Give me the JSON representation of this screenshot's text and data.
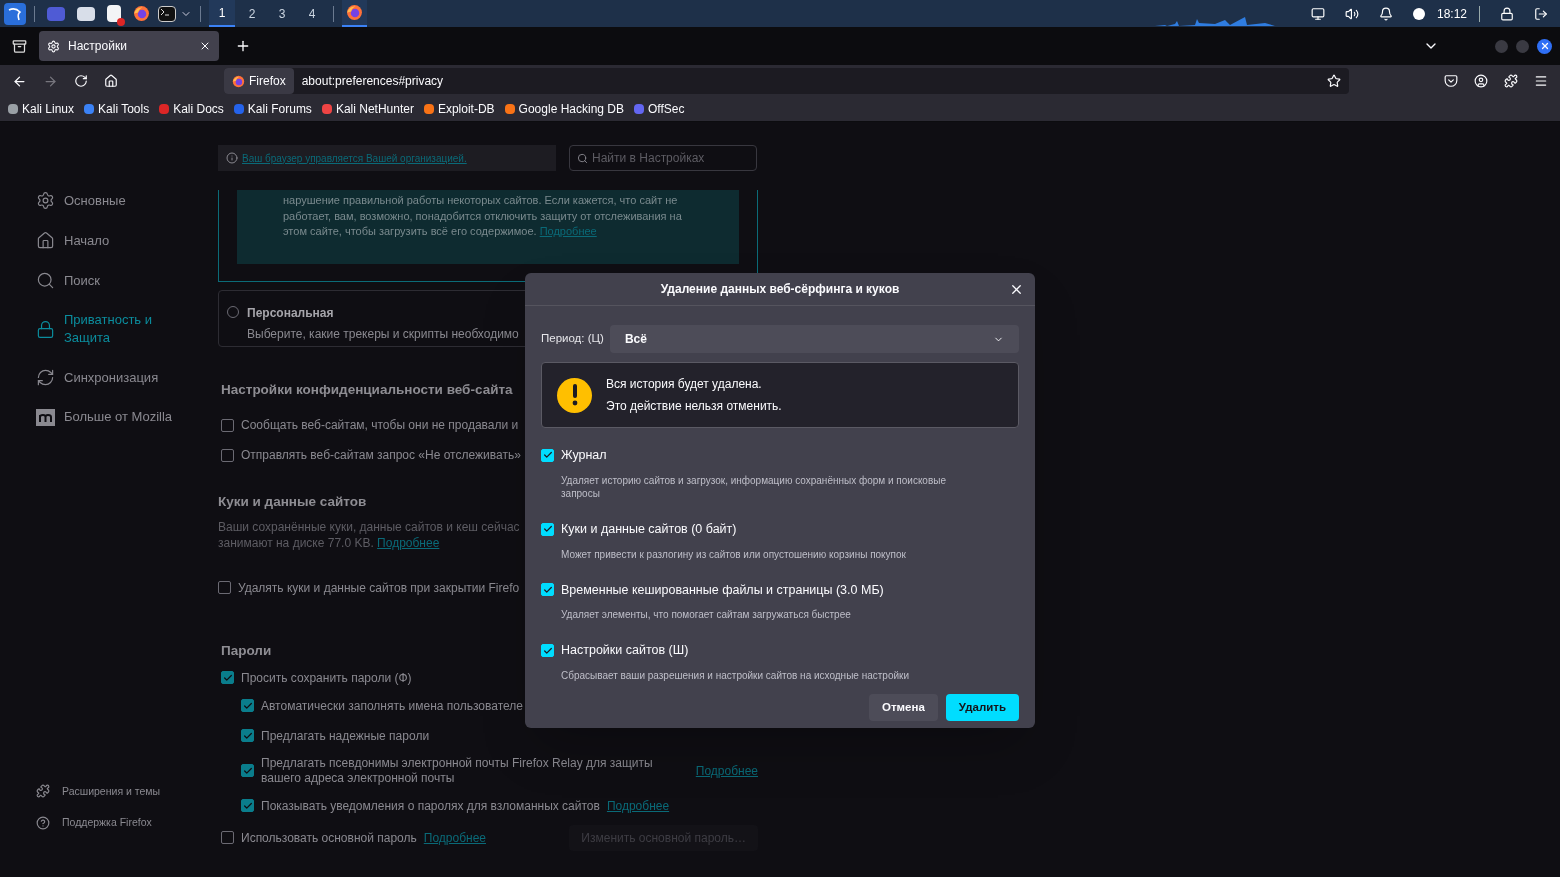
{
  "taskbar": {
    "workspaces": [
      {
        "label": "1",
        "selected": true
      },
      {
        "label": "2",
        "selected": false
      },
      {
        "label": "3",
        "selected": false
      },
      {
        "label": "4",
        "selected": false
      }
    ],
    "clock": "18:12"
  },
  "browser": {
    "tab": {
      "title": "Настройки"
    },
    "identity": "Firefox",
    "url": "about:preferences#privacy",
    "bookmarks": [
      {
        "label": "Kali Linux",
        "color": "#9aa0a6"
      },
      {
        "label": "Kali Tools",
        "color": "#3b82f6"
      },
      {
        "label": "Kali Docs",
        "color": "#dc2626"
      },
      {
        "label": "Kali Forums",
        "color": "#2563eb"
      },
      {
        "label": "Kali NetHunter",
        "color": "#ef4444"
      },
      {
        "label": "Exploit-DB",
        "color": "#f97316"
      },
      {
        "label": "Google Hacking DB",
        "color": "#f97316"
      },
      {
        "label": "OffSec",
        "color": "#6366f1"
      }
    ]
  },
  "settings": {
    "notice": {
      "text": "Ваш браузер управляется Вашей организацией."
    },
    "search": {
      "placeholder": "Найти в Настройках"
    },
    "sidebar": {
      "items": [
        {
          "label": "Основные",
          "selected": false
        },
        {
          "label": "Начало",
          "selected": false
        },
        {
          "label": "Поиск",
          "selected": false
        },
        {
          "label": "Приватность и Защита",
          "selected": true
        },
        {
          "label": "Синхронизация",
          "selected": false
        },
        {
          "label": "Больше от Mozilla",
          "selected": false
        }
      ],
      "footer": [
        "Расширения и темы",
        "Поддержка Firefox"
      ]
    },
    "tracking_card": {
      "text": "нарушение правильной работы некоторых сайтов. Если кажется, что сайт не работает, вам, возможно, понадобится отключить защиту от отслеживания на этом сайте, чтобы загрузить всё его содержимое.",
      "link": "Подробнее"
    },
    "custom_option": {
      "label": "Персональная",
      "description": "Выберите, какие трекеры и скрипты необходимо",
      "selected": false
    },
    "privacy_section": {
      "heading": "Настройки конфиденциальности веб-сайта",
      "options": [
        {
          "label": "Сообщать веб-сайтам, чтобы они не продавали и",
          "checked": false
        },
        {
          "label": "Отправлять веб-сайтам запрос «Не отслеживать»",
          "checked": false
        }
      ]
    },
    "cookies_section": {
      "heading": "Куки и данные сайтов",
      "description": "Ваши сохранённые куки, данные сайтов и кеш сейчас занимают на диске 77.0 KB.",
      "link": "Подробнее",
      "option": {
        "label": "Удалять куки и данные сайтов при закрытии Firefo",
        "checked": false
      }
    },
    "passwords_section": {
      "heading": "Пароли",
      "ask": {
        "label": "Просить сохранить пароли (Ф)",
        "checked": true
      },
      "children": [
        {
          "label": "Автоматически заполнять имена пользователе",
          "checked": true
        },
        {
          "label": "Предлагать надежные пароли",
          "checked": true
        },
        {
          "label": "Предлагать псевдонимы электронной почты Firefox Relay для защиты вашего адреса электронной почты",
          "checked": true,
          "link": "Подробнее",
          "kind": "wide"
        },
        {
          "label": "Показывать уведомления о паролях для взломанных сайтов",
          "checked": true,
          "link": "Подробнее",
          "kind": "inline"
        }
      ],
      "primary": {
        "label": "Использовать основной пароль",
        "checked": false,
        "link": "Подробнее",
        "button": "Изменить основной пароль…",
        "button_disabled": true
      }
    }
  },
  "dialog": {
    "title": "Удаление данных веб-сёрфинга и куков",
    "period": {
      "label": "Период: (Ц)",
      "value": "Всё"
    },
    "warning": [
      "Вся история будет удалена.",
      "Это действие нельзя отменить."
    ],
    "options": [
      {
        "label": "Журнал",
        "description": "Удаляет историю сайтов и загрузок, информацию сохранённых форм и поисковые запросы",
        "checked": true
      },
      {
        "label": "Куки и данные сайтов (0 байт)",
        "description": "Может привести к разлогину из сайтов или опустошению корзины покупок",
        "checked": true
      },
      {
        "label": "Временные кешированные файлы и страницы (3.0 МБ)",
        "description": "Удаляет элементы, что помогает сайтам загружаться быстрее",
        "checked": true
      },
      {
        "label": "Настройки сайтов (Ш)",
        "description": "Сбрасывает ваши разрешения и настройки сайтов на исходные настройки",
        "checked": true
      }
    ],
    "cancel": "Отмена",
    "confirm": "Удалить"
  }
}
